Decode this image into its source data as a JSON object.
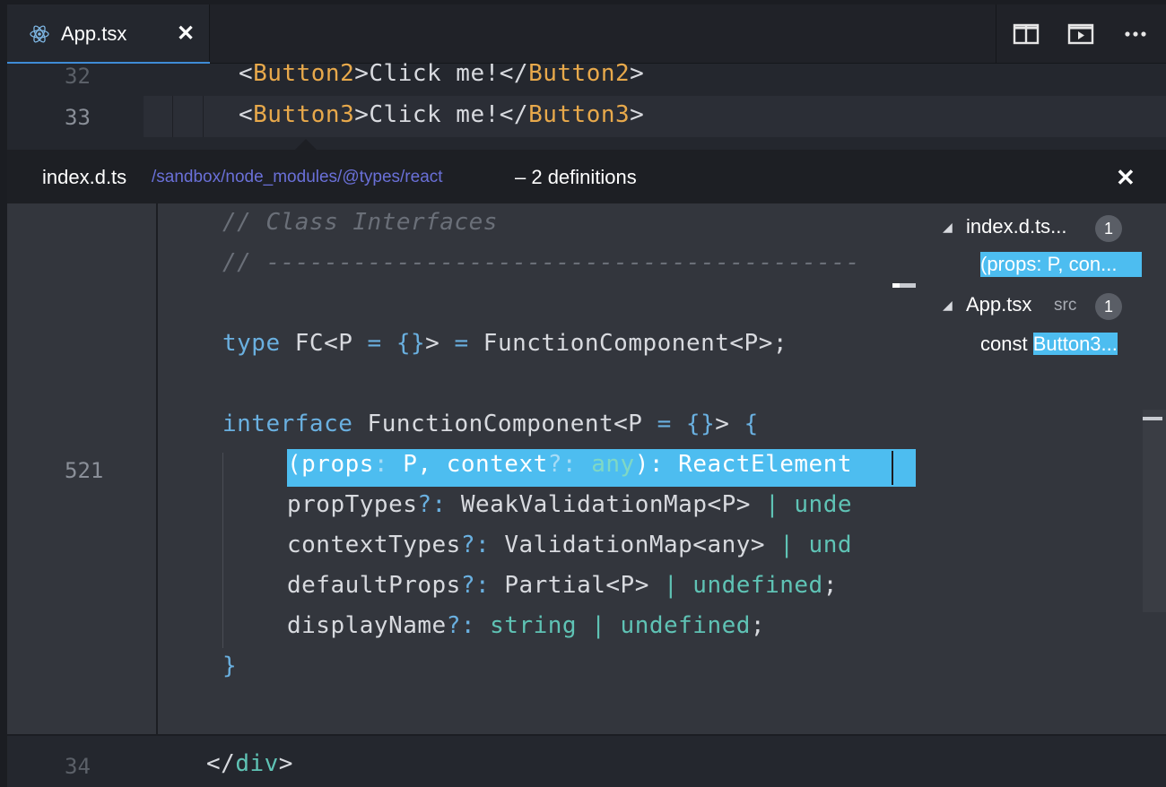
{
  "tab": {
    "label": "App.tsx",
    "close": "✕",
    "icon": "react-icon"
  },
  "actions": [
    {
      "icon": "split-editor-icon"
    },
    {
      "icon": "open-preview-icon"
    },
    {
      "icon": "more-actions-icon"
    }
  ],
  "editor_top": {
    "line32": {
      "number": "32",
      "open": "<",
      "tag": "Button2",
      "mid": ">Click me!</",
      "tag2": "Button2",
      "close": ">"
    },
    "line33": {
      "number": "33",
      "open": "<",
      "tag": "Button3",
      "mid": ">Click me!</",
      "tag2": "Button3",
      "close": ">"
    }
  },
  "peek": {
    "file": "index.d.ts",
    "path": "/sandbox/node_modules/@types/react",
    "count": "– 2 definitions",
    "close": "✕",
    "line_number": "521",
    "code": {
      "comment1": "// Class Interfaces",
      "comment2": "// -----------------------------------------",
      "type_kw": "type",
      "type_rest_a": " FC<P ",
      "type_eq": "=",
      "type_obj": " {}",
      "type_rest_b": "> ",
      "type_eq2": "=",
      "type_rest_c": " FunctionComponent<P>;",
      "iface_kw": "interface",
      "iface_rest_a": " FunctionComponent<P ",
      "iface_eq": "=",
      "iface_obj": " {}",
      "iface_rest_b": "> ",
      "iface_brace": "{",
      "hl_a": "(props",
      "hl_b": ": ",
      "hl_c": "P, context",
      "hl_d": "?: ",
      "hl_e": "any",
      "hl_f": "): ReactElement",
      "prop1_a": "propTypes",
      "prop1_b": "?: ",
      "prop1_c": "WeakValidationMap<P> ",
      "prop1_d": "| unde",
      "prop2_a": "contextTypes",
      "prop2_b": "?: ",
      "prop2_c": "ValidationMap<any> ",
      "prop2_d": "| und",
      "prop3_a": "defaultProps",
      "prop3_b": "?: ",
      "prop3_c": "Partial<P> ",
      "prop3_d": "| undefined",
      "prop3_e": ";",
      "prop4_a": "displayName",
      "prop4_b": "?: ",
      "prop4_c": "string",
      "prop4_d": " | undefined",
      "prop4_e": ";",
      "close_brace": "}"
    },
    "tree": {
      "group1": {
        "label": "index.d.ts...",
        "count": "1",
        "item": "(props: P, con..."
      },
      "group2": {
        "label": "App.tsx",
        "sub": "src",
        "count": "1",
        "item_a": "const ",
        "item_b": "Button3..."
      }
    }
  },
  "editor_bottom": {
    "number": "34",
    "open": "</",
    "tag": "div",
    "close": ">"
  }
}
